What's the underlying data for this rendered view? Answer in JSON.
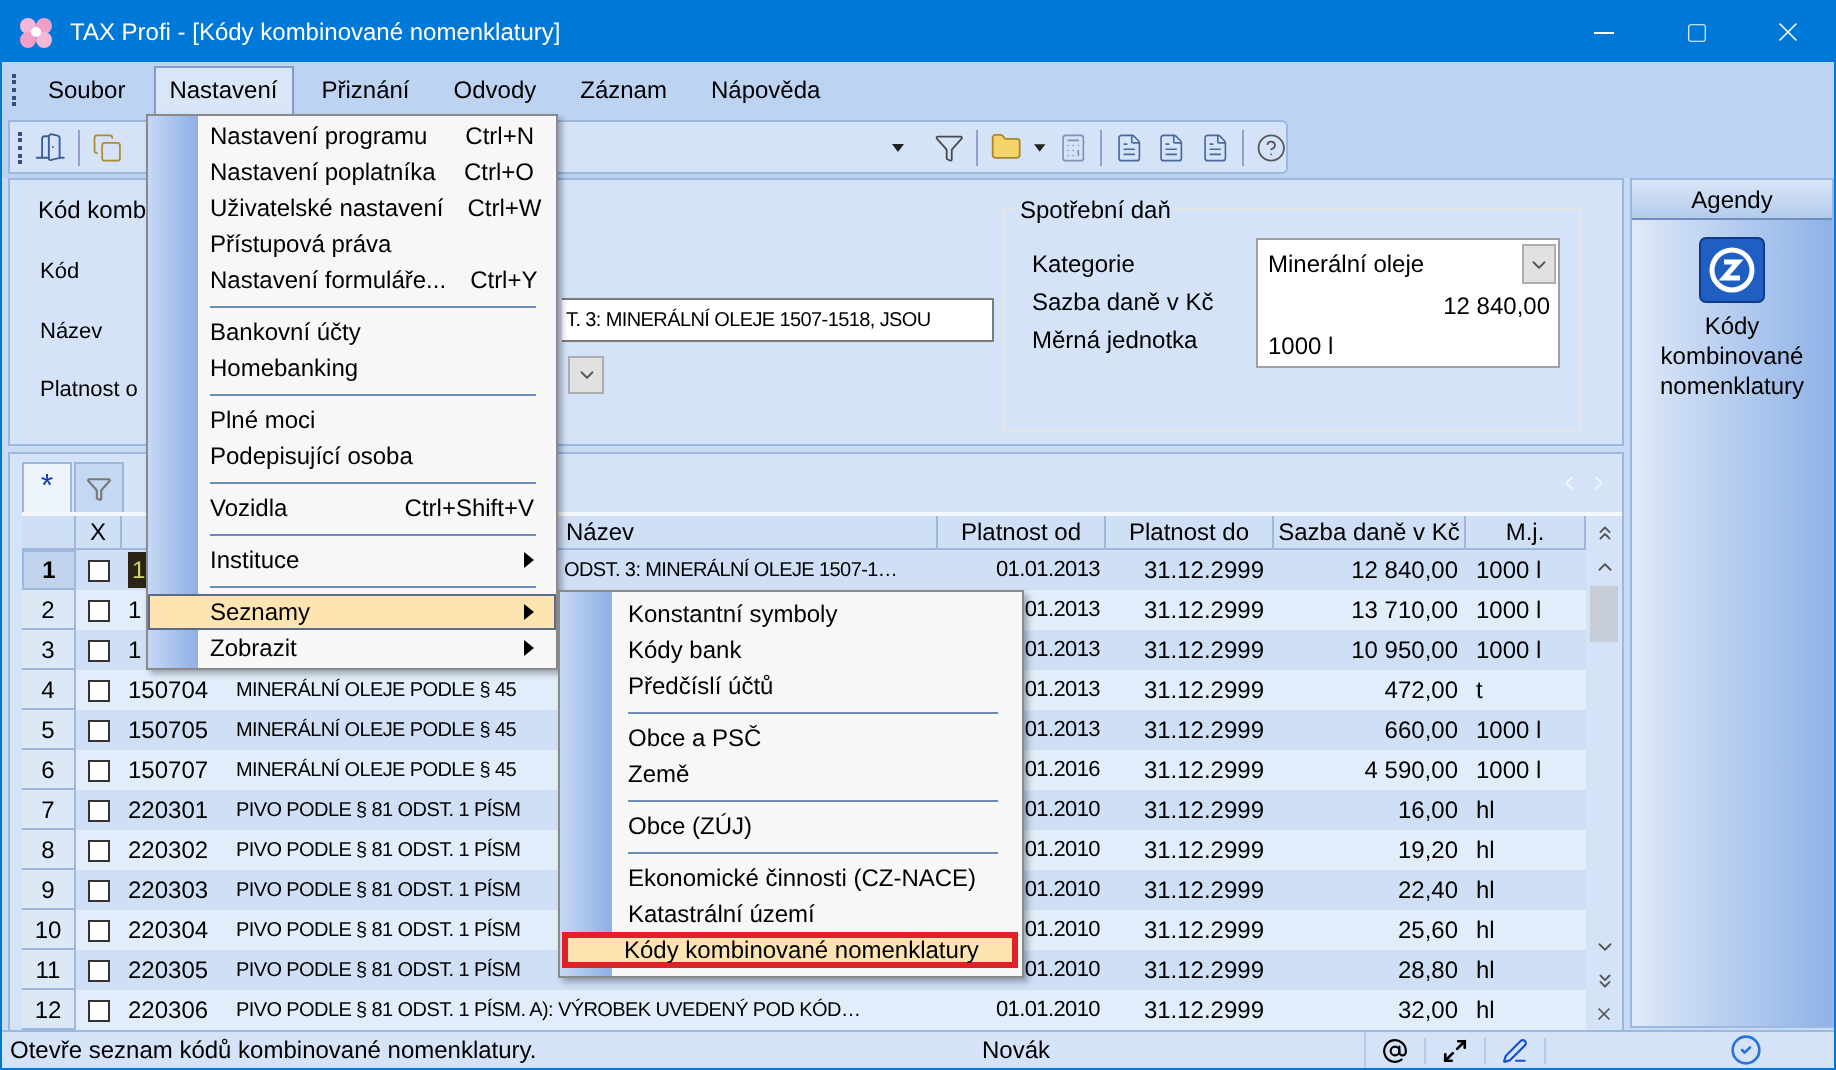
{
  "window": {
    "title": "TAX Profi - [Kódy kombinované nomenklatury]"
  },
  "menu_bar": [
    {
      "label": "Soubor",
      "selected": false
    },
    {
      "label": "Nastavení",
      "selected": true
    },
    {
      "label": "Přiznání",
      "selected": false
    },
    {
      "label": "Odvody",
      "selected": false
    },
    {
      "label": "Záznam",
      "selected": false
    },
    {
      "label": "Nápověda",
      "selected": false
    }
  ],
  "form": {
    "group_title": "Kód komb",
    "labels": [
      "Kód",
      "Název",
      "Platnost o"
    ],
    "name_value": "T. 3: MINERÁLNÍ OLEJE 1507-1518, JSOU",
    "excise": {
      "title": "Spotřební daň",
      "fields": [
        {
          "label": "Kategorie",
          "value": "Minerální oleje",
          "kind": "dropdown"
        },
        {
          "label": "Sazba daně v Kč",
          "value": "12 840,00",
          "kind": "number"
        },
        {
          "label": "Měrná jednotka",
          "value": "1000 l",
          "kind": "text"
        }
      ]
    }
  },
  "grid": {
    "tabs": [
      {
        "kind": "text",
        "label": "*",
        "selected": true
      },
      {
        "kind": "filter",
        "selected": false
      }
    ],
    "columns": {
      "check": "X",
      "name": "Název",
      "valid_from": "Platnost od",
      "valid_to": "Platnost do",
      "rate": "Sazba daně v Kč",
      "unit": "M.j."
    },
    "rows": [
      {
        "num": "1",
        "checked": false,
        "selected": true,
        "code": "1",
        "name": "ODST. 3: MINERÁLNÍ OLEJE 1507-1…",
        "from": "01.01.2013",
        "to": "31.12.2999",
        "rate": "12 840,00",
        "unit": "1000 l"
      },
      {
        "num": "2",
        "checked": false,
        "selected": false,
        "code": "1",
        "from": "01.2013",
        "to": "31.12.2999",
        "rate": "13 710,00",
        "unit": "1000 l"
      },
      {
        "num": "3",
        "checked": false,
        "selected": false,
        "code": "1",
        "from": "01.2013",
        "to": "31.12.2999",
        "rate": "10 950,00",
        "unit": "1000 l"
      },
      {
        "num": "4",
        "checked": false,
        "selected": false,
        "code": "150704",
        "name": "MINERÁLNÍ OLEJE PODLE § 45",
        "from": "01.2013",
        "to": "31.12.2999",
        "rate": "472,00",
        "unit": "t"
      },
      {
        "num": "5",
        "checked": false,
        "selected": false,
        "code": "150705",
        "name": "MINERÁLNÍ OLEJE PODLE § 45",
        "from": "01.2013",
        "to": "31.12.2999",
        "rate": "660,00",
        "unit": "1000 l"
      },
      {
        "num": "6",
        "checked": false,
        "selected": false,
        "code": "150707",
        "name": "MINERÁLNÍ OLEJE PODLE § 45",
        "from": "01.2016",
        "to": "31.12.2999",
        "rate": "4 590,00",
        "unit": "1000 l"
      },
      {
        "num": "7",
        "checked": false,
        "selected": false,
        "code": "220301",
        "name": "PIVO PODLE § 81 ODST. 1 PÍSM",
        "from": "01.2010",
        "to": "31.12.2999",
        "rate": "16,00",
        "unit": "hl"
      },
      {
        "num": "8",
        "checked": false,
        "selected": false,
        "code": "220302",
        "name": "PIVO PODLE § 81 ODST. 1 PÍSM",
        "from": "01.2010",
        "to": "31.12.2999",
        "rate": "19,20",
        "unit": "hl"
      },
      {
        "num": "9",
        "checked": false,
        "selected": false,
        "code": "220303",
        "name": "PIVO PODLE § 81 ODST. 1 PÍSM",
        "from": "01.2010",
        "to": "31.12.2999",
        "rate": "22,40",
        "unit": "hl"
      },
      {
        "num": "10",
        "checked": false,
        "selected": false,
        "code": "220304",
        "name": "PIVO PODLE § 81 ODST. 1 PÍSM",
        "from": "01.2010",
        "to": "31.12.2999",
        "rate": "25,60",
        "unit": "hl"
      },
      {
        "num": "11",
        "checked": false,
        "selected": false,
        "code": "220305",
        "name": "PIVO PODLE § 81 ODST. 1 PÍSM",
        "from": "01.2010",
        "to": "31.12.2999",
        "rate": "28,80",
        "unit": "hl"
      },
      {
        "num": "12",
        "checked": false,
        "selected": false,
        "code": "220306",
        "name": "PIVO PODLE § 81 ODST. 1 PÍSM. A): VÝROBEK UVEDENÝ POD KÓD…",
        "from": "01.01.2010",
        "to": "31.12.2999",
        "rate": "32,00",
        "unit": "hl"
      }
    ]
  },
  "agendy": {
    "title": "Agendy",
    "item": "Kódy kombinované nomenklatury"
  },
  "menu": {
    "items": [
      {
        "kind": "item",
        "label": "Nastavení programu",
        "shortcut": "Ctrl+N",
        "selected": false
      },
      {
        "kind": "item",
        "label": "Nastavení poplatníka",
        "shortcut": "Ctrl+O",
        "selected": false
      },
      {
        "kind": "item",
        "label": "Uživatelské nastavení",
        "shortcut": "Ctrl+W",
        "selected": false
      },
      {
        "kind": "item",
        "label": "Přístupová práva",
        "selected": false
      },
      {
        "kind": "item",
        "label": "Nastavení formuláře...",
        "shortcut": "Ctrl+Y",
        "selected": false
      },
      {
        "kind": "separator"
      },
      {
        "kind": "item",
        "label": "Bankovní účty",
        "selected": false
      },
      {
        "kind": "item",
        "label": "Homebanking",
        "selected": false
      },
      {
        "kind": "separator"
      },
      {
        "kind": "item",
        "label": "Plné moci",
        "selected": false
      },
      {
        "kind": "item",
        "label": "Podepisující osoba",
        "selected": false
      },
      {
        "kind": "separator"
      },
      {
        "kind": "item",
        "label": "Vozidla",
        "shortcut": "Ctrl+Shift+V",
        "selected": false
      },
      {
        "kind": "separator"
      },
      {
        "kind": "submenu",
        "label": "Instituce",
        "selected": false
      },
      {
        "kind": "separator"
      },
      {
        "kind": "submenu",
        "label": "Seznamy",
        "selected": true
      },
      {
        "kind": "submenu",
        "label": "Zobrazit",
        "selected": false
      }
    ]
  },
  "submenu": {
    "items": [
      {
        "kind": "item",
        "label": "Konstantní symboly",
        "selected": false
      },
      {
        "kind": "item",
        "label": "Kódy bank",
        "selected": false
      },
      {
        "kind": "item",
        "label": "Předčíslí účtů",
        "selected": false
      },
      {
        "kind": "separator"
      },
      {
        "kind": "item",
        "label": "Obce a PSČ",
        "selected": false
      },
      {
        "kind": "item",
        "label": "Země",
        "selected": false
      },
      {
        "kind": "separator"
      },
      {
        "kind": "item",
        "label": "Obce (ZÚJ)",
        "selected": false
      },
      {
        "kind": "separator"
      },
      {
        "kind": "item",
        "label": "Ekonomické činnosti (CZ-NACE)",
        "selected": false
      },
      {
        "kind": "item",
        "label": "Katastrální území",
        "selected": false
      },
      {
        "kind": "item",
        "label": "Kódy kombinované nomenklatury",
        "selected": true
      }
    ]
  },
  "status_bar": {
    "message": "Otevře seznam kódů kombinované nomenklatury.",
    "user": "Novák"
  }
}
